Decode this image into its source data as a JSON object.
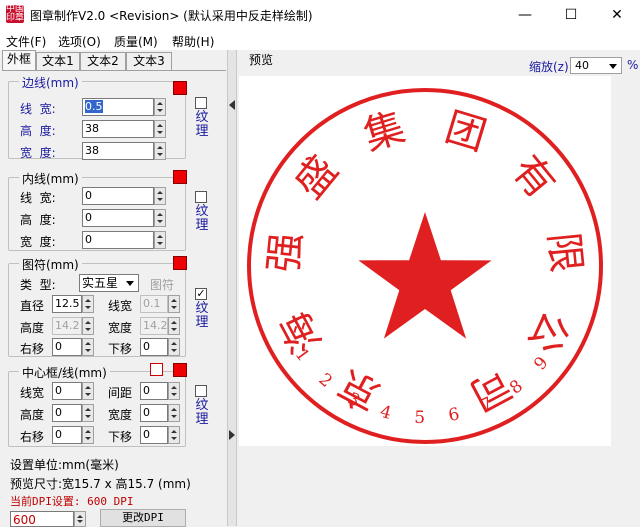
{
  "window": {
    "title": "图章制作V2.0 <Revision> (默认采用中反走样绘制)",
    "app_icon_text": "中国印章",
    "minimize": "—",
    "maximize": "☐",
    "close": "✕"
  },
  "menu": [
    "文件(F)",
    "选项(O)",
    "质量(M)",
    "帮助(H)"
  ],
  "tabs": [
    "外框",
    "文本1",
    "文本2",
    "文本3"
  ],
  "border_group": {
    "legend": "边线(mm)",
    "fields": [
      {
        "label": "线  宽:",
        "value": "0.5"
      },
      {
        "label": "高  度:",
        "value": "38"
      },
      {
        "label": "宽  度:",
        "value": "38"
      }
    ],
    "texture": "纹理",
    "texture_checked": false
  },
  "inner_group": {
    "legend": "内线(mm)",
    "fields": [
      {
        "label": "线  宽:",
        "value": "0"
      },
      {
        "label": "高  度:",
        "value": "0"
      },
      {
        "label": "宽  度:",
        "value": "0"
      }
    ],
    "texture": "纹理",
    "texture_checked": false
  },
  "symbol_group": {
    "legend": "图符(mm)",
    "type_label": "类  型:",
    "type_value": "实五星",
    "symbol_button": "图符",
    "diameter_label": "直径",
    "diameter_value": "12.5",
    "linewidth_label": "线宽",
    "linewidth_value": "0.1",
    "height_label": "高度",
    "height_value": "14.2",
    "width_label": "宽度",
    "width_value": "14.2",
    "right_label": "右移",
    "right_value": "0",
    "down_label": "下移",
    "down_value": "0",
    "texture": "纹理",
    "texture_checked": true,
    "check_mark": "✓"
  },
  "center_group": {
    "legend": "中心框/线(mm)",
    "linewidth_label": "线宽",
    "linewidth_value": "0",
    "spacing_label": "间距",
    "spacing_value": "0",
    "height_label": "高度",
    "height_value": "0",
    "width_label": "宽度",
    "width_value": "0",
    "right_label": "右移",
    "right_value": "0",
    "down_label": "下移",
    "down_value": "0",
    "texture": "纹理",
    "texture_checked": false
  },
  "status": {
    "unit": "设置单位:mm(毫米)",
    "preview_size": "预览尺寸:宽15.7 x 高15.7 (mm)",
    "dpi": "当前DPI设置: 600 DPI",
    "dpi_value": "600",
    "change_dpi": "更改DPI"
  },
  "preview": {
    "title": "预览",
    "zoom_label": "缩放(z)",
    "zoom_value": "40",
    "zoom_unit": "%"
  },
  "stamp": {
    "company_chars": [
      "京",
      "海",
      "强",
      "盛",
      "集",
      "团",
      "有",
      "限",
      "公",
      "司"
    ],
    "code_digits": [
      "1",
      "2",
      "3",
      "4",
      "5",
      "6",
      "7",
      "8",
      "9"
    ],
    "color": "#e02020"
  },
  "colors": {
    "stamp_red": "#e02020",
    "swatch_red": "#ee0000",
    "label_blue": "#1a1aa0",
    "status_red": "#c00000"
  }
}
